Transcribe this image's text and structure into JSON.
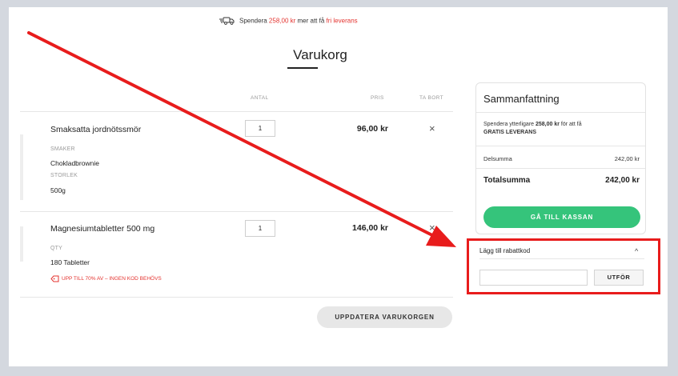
{
  "shipping_banner": {
    "prefix": "Spendera ",
    "amount": "258,00 kr",
    "middle": " mer att få ",
    "link": "fri leverans"
  },
  "page_title": "Varukorg",
  "table_headers": {
    "quantity": "ANTAL",
    "price": "PRIS",
    "remove": "TA BORT"
  },
  "items": [
    {
      "name": "Smaksatta jordnötssmör",
      "attr1_label": "SMAKER",
      "attr1_value": "Chokladbrownie",
      "attr2_label": "STORLEK",
      "attr2_value": "500g",
      "quantity": "1",
      "price": "96,00 kr",
      "remove": "×"
    },
    {
      "name": "Magnesiumtabletter 500 mg",
      "attr1_label": "QTY",
      "attr1_value": "180 Tabletter",
      "promo": "UPP TILL 70% AV – INGEN KOD BEHÖVS",
      "quantity": "1",
      "price": "146,00 kr",
      "remove": "×"
    }
  ],
  "update_button": "UPPDATERA VARUKORGEN",
  "summary": {
    "title": "Sammanfattning",
    "note_prefix": "Spendera ytterligare ",
    "note_amount": "258,00 kr",
    "note_middle": " för att få",
    "note_free": "GRATIS LEVERANS",
    "subtotal_label": "Delsumma",
    "subtotal_value": "242,00 kr",
    "total_label": "Totalsumma",
    "total_value": "242,00 kr",
    "checkout_button": "GÅ TILL KASSAN"
  },
  "coupon": {
    "title": "Lägg till rabattkod",
    "chevron": "^",
    "input_value": "",
    "apply_button": "UTFÖR"
  },
  "colors": {
    "accent_red": "#e4332f",
    "checkout_green": "#35c47b",
    "highlight_red": "#e81c1c"
  }
}
